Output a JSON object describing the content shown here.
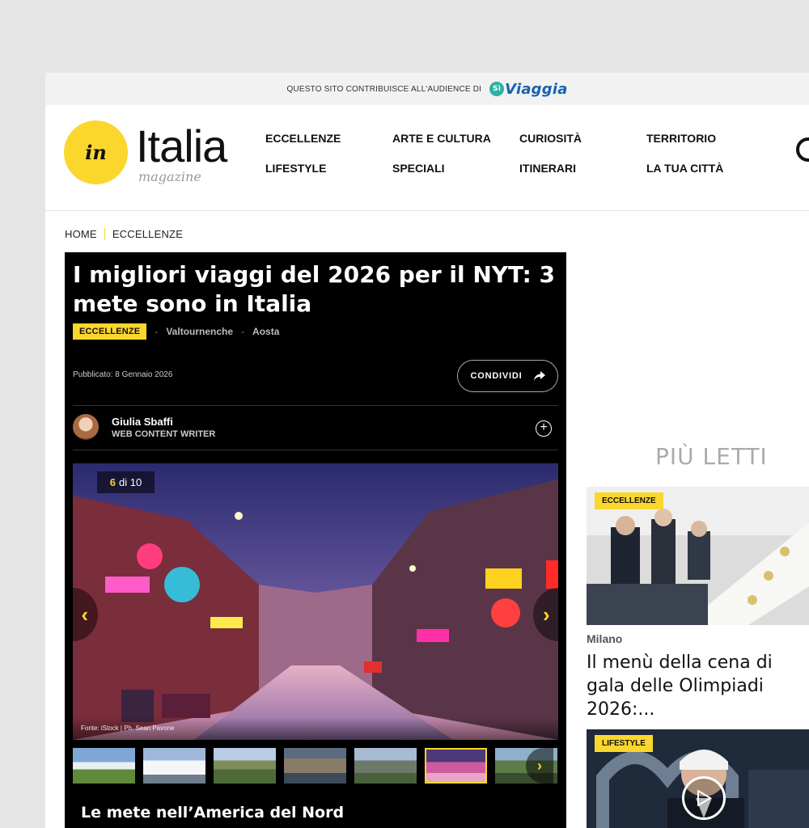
{
  "network_bar": {
    "text": "QUESTO SITO CONTRIBUISCE ALL'AUDIENCE DI",
    "brand_si": "Sì",
    "brand_name": "Viaggia"
  },
  "logo": {
    "badge": "in",
    "word": "Italia",
    "sub": "magazine"
  },
  "nav": [
    "ECCELLENZE",
    "ARTE E CULTURA",
    "CURIOSITÀ",
    "TERRITORIO",
    "LIFESTYLE",
    "SPECIALI",
    "ITINERARI",
    "LA TUA CITTÀ"
  ],
  "breadcrumb": [
    "HOME",
    "ECCELLENZE"
  ],
  "article": {
    "title": "I migliori viaggi del 2026 per il NYT: 3 mete sono in Italia",
    "category": "ECCELLENZE",
    "places": [
      "Valtournenche",
      "Aosta"
    ],
    "published": "Pubblicato: 8 Gennaio 2026",
    "share_label": "CONDIVIDI",
    "author_name": "Giulia Sbaffi",
    "author_role": "WEB CONTENT WRITER",
    "gallery": {
      "current": "6",
      "of": "di 10",
      "credit": "Fonte: iStock | Ph. Sean Pavone"
    },
    "section_title": "Le mete nell’America del Nord"
  },
  "sidebar": {
    "most_read_title": "PIÙ LETTI",
    "cards": [
      {
        "category": "ECCELLENZE",
        "city": "Milano",
        "headline": "Il menù della cena di gala delle Olimpiadi 2026:..."
      },
      {
        "category": "LIFESTYLE"
      }
    ]
  },
  "colors": {
    "accent": "#fbd62c",
    "article_bg": "#000000",
    "brand_blue": "#1a62b0"
  }
}
